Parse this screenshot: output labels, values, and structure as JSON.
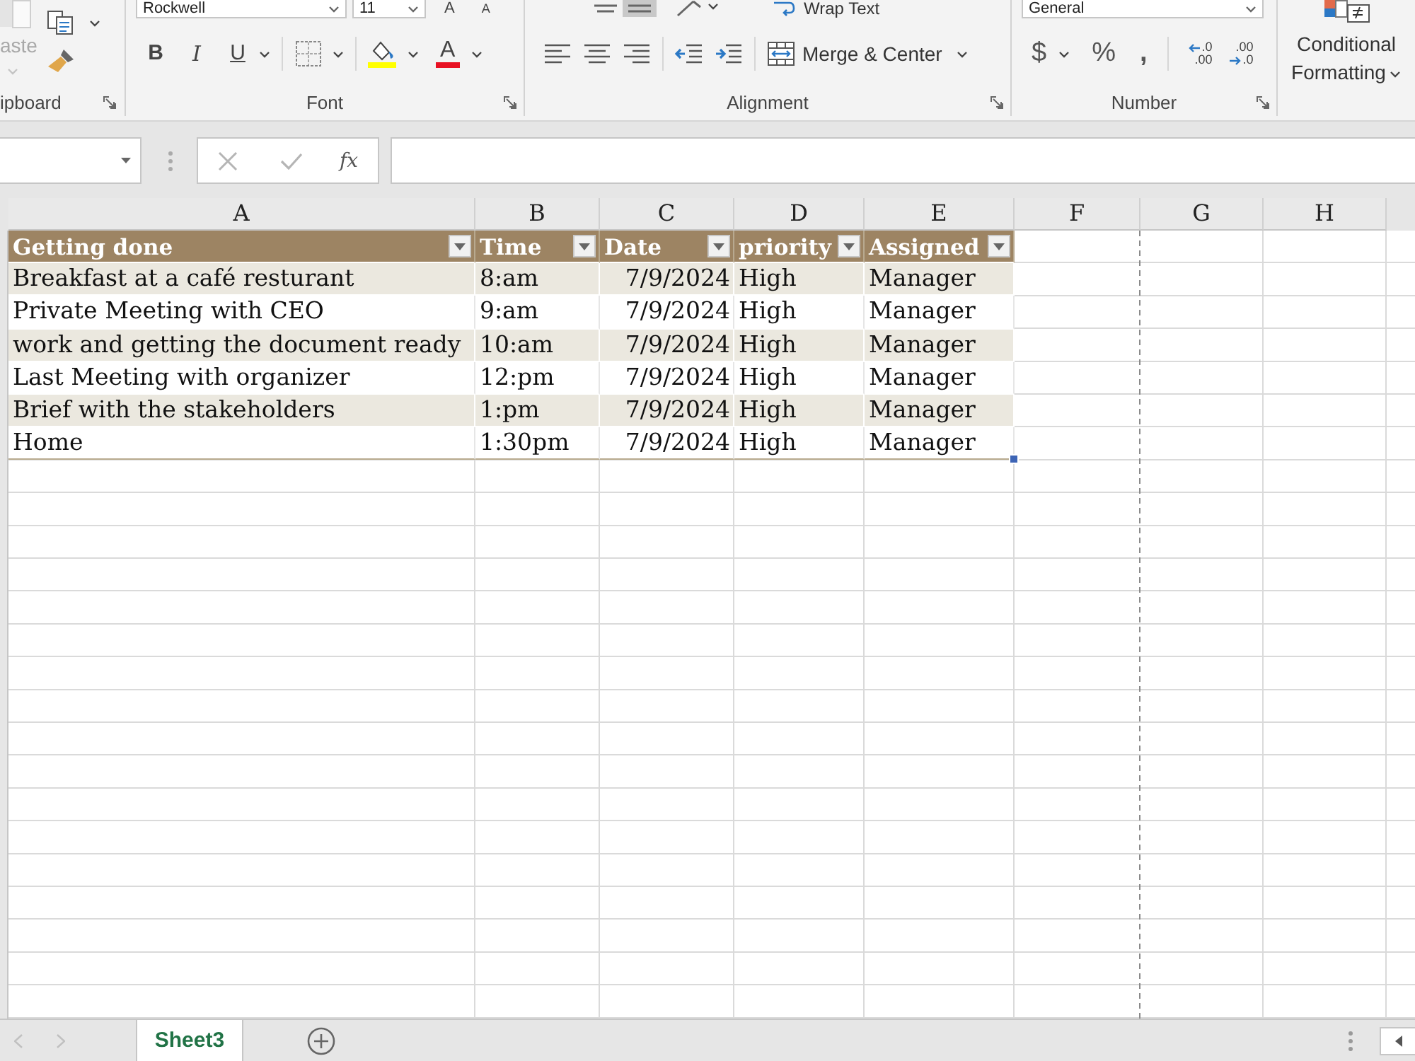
{
  "ribbon": {
    "clipboard": {
      "paste": {
        "label": "aste",
        "disabled": true
      },
      "label": "ipboard"
    },
    "font": {
      "font_name": "Rockwell",
      "font_size": "11",
      "grow": "A",
      "shrink": "A",
      "bold": "B",
      "italic": "I",
      "underline": "U",
      "font_color": "A",
      "label": "Font"
    },
    "alignment": {
      "vertical_align": [
        {
          "selected": false
        },
        {
          "selected": true
        }
      ],
      "wrap_text": "Wrap Text",
      "merge_center": "Merge & Center",
      "label": "Alignment"
    },
    "number": {
      "format": "General",
      "currency": "$",
      "percent": "%",
      "comma": ",",
      "decimals": [
        {
          "top": ".0",
          "bottom": ".00"
        },
        {
          "top": ".00",
          "bottom": ".0"
        }
      ],
      "label": "Number"
    },
    "styles": {
      "conditional_formatting": "Conditional Formatting"
    }
  },
  "formula_bar": {
    "function_label": "fx"
  },
  "sheet": {
    "column_letters": [
      "A",
      "B",
      "C",
      "D",
      "E",
      "F",
      "G",
      "H"
    ],
    "table": {
      "banded": true,
      "columns": [
        {
          "label": "Getting done",
          "kind": "text"
        },
        {
          "label": "Time",
          "kind": "text"
        },
        {
          "label": "Date",
          "kind": "number"
        },
        {
          "label": "priority",
          "kind": "text"
        },
        {
          "label": "Assigned",
          "kind": "text"
        }
      ],
      "rows": [
        [
          "Breakfast at a café resturant",
          "8:am",
          "7/9/2024",
          "High",
          "Manager"
        ],
        [
          "Private Meeting with CEO",
          "9:am",
          "7/9/2024",
          "High",
          "Manager"
        ],
        [
          "work and getting the document ready",
          "10:am",
          "7/9/2024",
          "High",
          "Manager"
        ],
        [
          "Last Meeting with organizer",
          "12:pm",
          "7/9/2024",
          "High",
          "Manager"
        ],
        [
          "Brief with the stakeholders",
          "1:pm",
          "7/9/2024",
          "High",
          "Manager"
        ],
        [
          "Home",
          "1:30pm",
          "7/9/2024",
          "High",
          "Manager"
        ]
      ]
    }
  },
  "sheet_tabs": [
    {
      "label": "Sheet3",
      "selected": true
    }
  ]
}
